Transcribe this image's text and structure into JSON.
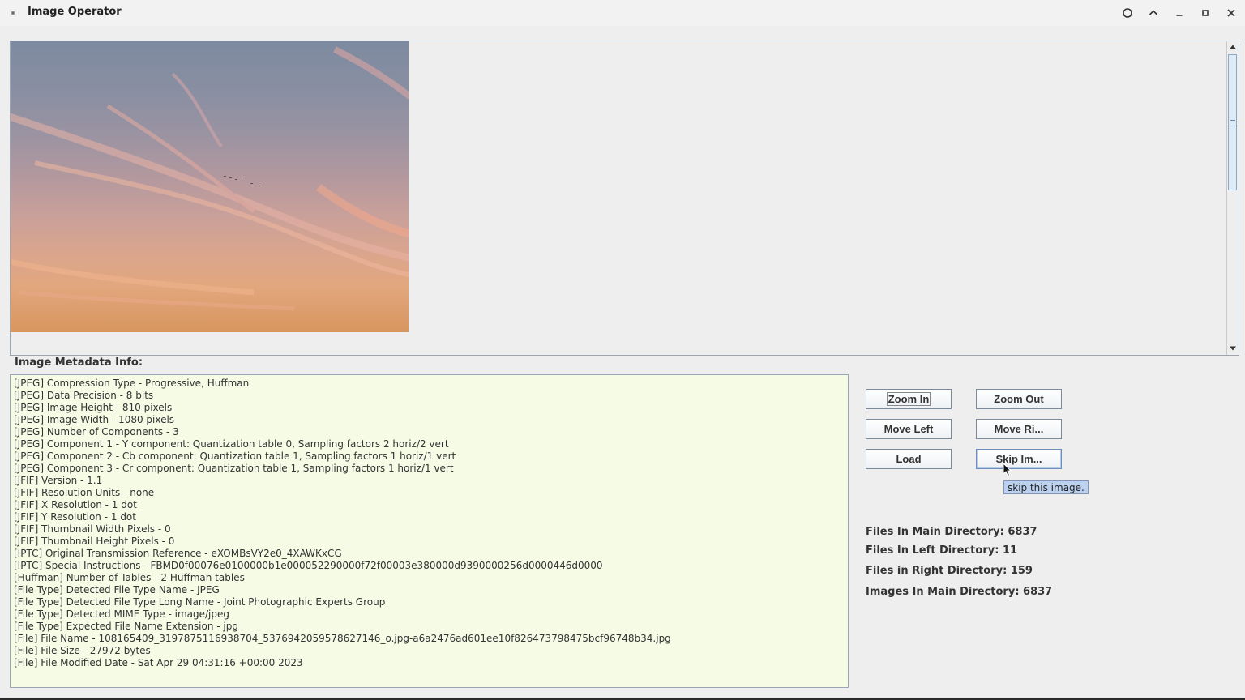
{
  "window": {
    "title": "Image Operator"
  },
  "titlebar_icons": [
    "circle-icon",
    "chevron-up-icon",
    "minimize-icon",
    "maximize-icon",
    "close-icon"
  ],
  "metadata": {
    "label": "Image Metadata Info:",
    "lines": [
      "[JPEG] Compression Type - Progressive, Huffman",
      "[JPEG] Data Precision - 8 bits",
      "[JPEG] Image Height - 810 pixels",
      "[JPEG] Image Width - 1080 pixels",
      "[JPEG] Number of Components - 3",
      "[JPEG] Component 1 - Y component: Quantization table 0, Sampling factors 2 horiz/2 vert",
      "[JPEG] Component 2 - Cb component: Quantization table 1, Sampling factors 1 horiz/1 vert",
      "[JPEG] Component 3 - Cr component: Quantization table 1, Sampling factors 1 horiz/1 vert",
      "[JFIF] Version - 1.1",
      "[JFIF] Resolution Units - none",
      "[JFIF] X Resolution - 1 dot",
      "[JFIF] Y Resolution - 1 dot",
      "[JFIF] Thumbnail Width Pixels - 0",
      "[JFIF] Thumbnail Height Pixels - 0",
      "[IPTC] Original Transmission Reference - eXOMBsVY2e0_4XAWKxCG",
      "[IPTC] Special Instructions - FBMD0f00076e0100000b1e000052290000f72f00003e380000d9390000256d0000446d0000",
      "[Huffman] Number of Tables - 2 Huffman tables",
      "[File Type] Detected File Type Name - JPEG",
      "[File Type] Detected File Type Long Name - Joint Photographic Experts Group",
      "[File Type] Detected MIME Type - image/jpeg",
      "[File Type] Expected File Name Extension - jpg",
      "[File] File Name - 108165409_3197875116938704_5376942059578627146_o.jpg-a6a2476ad601ee10f826473798475bcf96748b34.jpg",
      "[File] File Size - 27972 bytes",
      "[File] File Modified Date - Sat Apr 29 04:31:16 +00:00 2023"
    ]
  },
  "buttons": {
    "zoom_in": "Zoom In",
    "zoom_out": "Zoom Out",
    "move_left": "Move Left",
    "move_right": "Move Ri...",
    "load": "Load",
    "skip_image": "Skip Im..."
  },
  "tooltip": {
    "text": "skip this image."
  },
  "stats": {
    "files_main": "Files In Main Directory: 6837",
    "files_left": "Files In Left Directory: 11",
    "files_right": "Files in Right Directory: 159",
    "images_main": "Images In Main Directory: 6837"
  }
}
